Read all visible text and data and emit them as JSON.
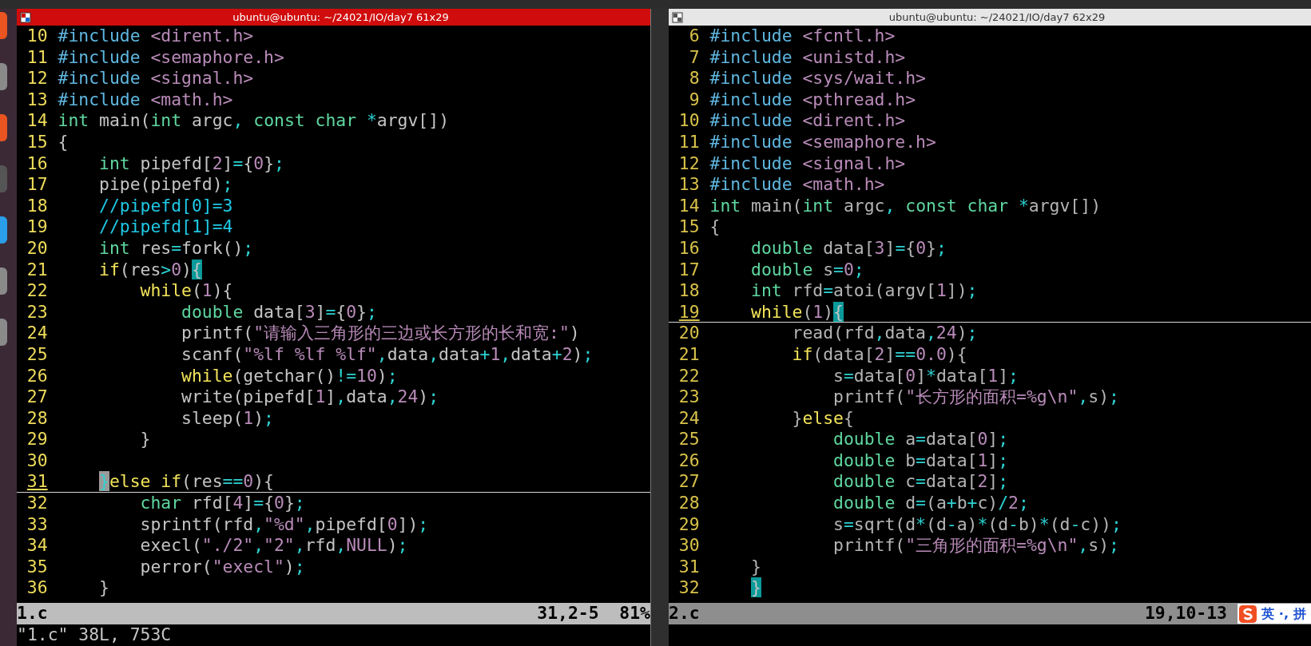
{
  "windows": [
    {
      "title": "ubuntu@ubuntu: ~/24021/IO/day7 61x29",
      "active": true,
      "lines": [
        {
          "n": "10",
          "cursorline": false,
          "tokens": [
            {
              "t": "#include",
              "kind": "pre"
            },
            {
              "t": " <dirent.h>",
              "kind": "str"
            }
          ]
        },
        {
          "n": "11",
          "cursorline": false,
          "tokens": [
            {
              "t": "#include",
              "kind": "pre"
            },
            {
              "t": " <semaphore.h>",
              "kind": "str"
            }
          ]
        },
        {
          "n": "12",
          "cursorline": false,
          "tokens": [
            {
              "t": "#include",
              "kind": "pre"
            },
            {
              "t": " <signal.h>",
              "kind": "str"
            }
          ]
        },
        {
          "n": "13",
          "cursorline": false,
          "tokens": [
            {
              "t": "#include",
              "kind": "pre"
            },
            {
              "t": " <math.h>",
              "kind": "str"
            }
          ]
        },
        {
          "n": "14",
          "cursorline": false,
          "tokens": [
            {
              "t": "int",
              "kind": "type"
            },
            {
              "t": " main(",
              "kind": "txt"
            },
            {
              "t": "int",
              "kind": "type"
            },
            {
              "t": " argc",
              "kind": "txt"
            },
            {
              "t": ",",
              "kind": "op"
            },
            {
              "t": " const",
              "kind": "type"
            },
            {
              "t": " char",
              "kind": "type"
            },
            {
              "t": " *",
              "kind": "op"
            },
            {
              "t": "argv[])",
              "kind": "txt"
            }
          ]
        },
        {
          "n": "15",
          "cursorline": false,
          "tokens": [
            {
              "t": "{",
              "kind": "txt"
            }
          ]
        },
        {
          "n": "16",
          "cursorline": false,
          "tokens": [
            {
              "t": "    int",
              "kind": "type"
            },
            {
              "t": " pipefd[",
              "kind": "txt"
            },
            {
              "t": "2",
              "kind": "num"
            },
            {
              "t": "]",
              "kind": "txt"
            },
            {
              "t": "=",
              "kind": "op"
            },
            {
              "t": "{",
              "kind": "txt"
            },
            {
              "t": "0",
              "kind": "num"
            },
            {
              "t": "}",
              "kind": "txt"
            },
            {
              "t": ";",
              "kind": "op"
            }
          ]
        },
        {
          "n": "17",
          "cursorline": false,
          "tokens": [
            {
              "t": "    pipe(pipefd)",
              "kind": "txt"
            },
            {
              "t": ";",
              "kind": "op"
            }
          ]
        },
        {
          "n": "18",
          "cursorline": false,
          "tokens": [
            {
              "t": "    //pipefd[0]=3",
              "kind": "cmt"
            }
          ]
        },
        {
          "n": "19",
          "cursorline": false,
          "tokens": [
            {
              "t": "    //pipefd[1]=4",
              "kind": "cmt"
            }
          ]
        },
        {
          "n": "20",
          "cursorline": false,
          "tokens": [
            {
              "t": "    int",
              "kind": "type"
            },
            {
              "t": " res",
              "kind": "txt"
            },
            {
              "t": "=",
              "kind": "op"
            },
            {
              "t": "fork()",
              "kind": "txt"
            },
            {
              "t": ";",
              "kind": "op"
            }
          ]
        },
        {
          "n": "21",
          "cursorline": false,
          "tokens": [
            {
              "t": "    if",
              "kind": "stmt"
            },
            {
              "t": "(res",
              "kind": "txt"
            },
            {
              "t": ">",
              "kind": "op"
            },
            {
              "t": "0",
              "kind": "num"
            },
            {
              "t": ")",
              "kind": "txt"
            },
            {
              "t": "{",
              "kind": "match"
            }
          ]
        },
        {
          "n": "22",
          "cursorline": false,
          "tokens": [
            {
              "t": "        while",
              "kind": "stmt"
            },
            {
              "t": "(",
              "kind": "txt"
            },
            {
              "t": "1",
              "kind": "num"
            },
            {
              "t": "){",
              "kind": "txt"
            }
          ]
        },
        {
          "n": "23",
          "cursorline": false,
          "tokens": [
            {
              "t": "            double",
              "kind": "type"
            },
            {
              "t": " data[",
              "kind": "txt"
            },
            {
              "t": "3",
              "kind": "num"
            },
            {
              "t": "]",
              "kind": "txt"
            },
            {
              "t": "=",
              "kind": "op"
            },
            {
              "t": "{",
              "kind": "txt"
            },
            {
              "t": "0",
              "kind": "num"
            },
            {
              "t": "}",
              "kind": "txt"
            },
            {
              "t": ";",
              "kind": "op"
            }
          ]
        },
        {
          "n": "24",
          "cursorline": false,
          "tokens": [
            {
              "t": "            printf(",
              "kind": "txt"
            },
            {
              "t": "\"请输入三角形的三边或长方形的长和宽:\"",
              "kind": "str"
            },
            {
              "t": ")",
              "kind": "txt"
            }
          ]
        },
        {
          "n": "25",
          "cursorline": false,
          "tokens": [
            {
              "t": "            scanf(",
              "kind": "txt"
            },
            {
              "t": "\"%lf %lf %lf\"",
              "kind": "str"
            },
            {
              "t": ",",
              "kind": "op"
            },
            {
              "t": "data",
              "kind": "txt"
            },
            {
              "t": ",",
              "kind": "op"
            },
            {
              "t": "data",
              "kind": "txt"
            },
            {
              "t": "+",
              "kind": "op"
            },
            {
              "t": "1",
              "kind": "num"
            },
            {
              "t": ",",
              "kind": "op"
            },
            {
              "t": "data",
              "kind": "txt"
            },
            {
              "t": "+",
              "kind": "op"
            },
            {
              "t": "2",
              "kind": "num"
            },
            {
              "t": ")",
              "kind": "txt"
            },
            {
              "t": ";",
              "kind": "op"
            }
          ]
        },
        {
          "n": "26",
          "cursorline": false,
          "tokens": [
            {
              "t": "            while",
              "kind": "stmt"
            },
            {
              "t": "(getchar()",
              "kind": "txt"
            },
            {
              "t": "!=",
              "kind": "op"
            },
            {
              "t": "10",
              "kind": "num"
            },
            {
              "t": ")",
              "kind": "txt"
            },
            {
              "t": ";",
              "kind": "op"
            }
          ]
        },
        {
          "n": "27",
          "cursorline": false,
          "tokens": [
            {
              "t": "            write(pipefd[",
              "kind": "txt"
            },
            {
              "t": "1",
              "kind": "num"
            },
            {
              "t": "]",
              "kind": "txt"
            },
            {
              "t": ",",
              "kind": "op"
            },
            {
              "t": "data",
              "kind": "txt"
            },
            {
              "t": ",",
              "kind": "op"
            },
            {
              "t": "24",
              "kind": "num"
            },
            {
              "t": ")",
              "kind": "txt"
            },
            {
              "t": ";",
              "kind": "op"
            }
          ]
        },
        {
          "n": "28",
          "cursorline": false,
          "tokens": [
            {
              "t": "            sleep(",
              "kind": "txt"
            },
            {
              "t": "1",
              "kind": "num"
            },
            {
              "t": ")",
              "kind": "txt"
            },
            {
              "t": ";",
              "kind": "op"
            }
          ]
        },
        {
          "n": "29",
          "cursorline": false,
          "tokens": [
            {
              "t": "        }",
              "kind": "txt"
            }
          ]
        },
        {
          "n": "30",
          "cursorline": false
        },
        {
          "n": "31",
          "cursorline": true,
          "tokens": [
            {
              "t": "    }",
              "kind": "cursor"
            },
            {
              "t": "else if",
              "kind": "stmt"
            },
            {
              "t": "(res",
              "kind": "txt"
            },
            {
              "t": "==",
              "kind": "op"
            },
            {
              "t": "0",
              "kind": "num"
            },
            {
              "t": "){",
              "kind": "txt"
            }
          ]
        },
        {
          "n": "32",
          "cursorline": false,
          "tokens": [
            {
              "t": "        char",
              "kind": "type"
            },
            {
              "t": " rfd[",
              "kind": "txt"
            },
            {
              "t": "4",
              "kind": "num"
            },
            {
              "t": "]",
              "kind": "txt"
            },
            {
              "t": "=",
              "kind": "op"
            },
            {
              "t": "{",
              "kind": "txt"
            },
            {
              "t": "0",
              "kind": "num"
            },
            {
              "t": "}",
              "kind": "txt"
            },
            {
              "t": ";",
              "kind": "op"
            }
          ]
        },
        {
          "n": "33",
          "cursorline": false,
          "tokens": [
            {
              "t": "        sprintf(rfd",
              "kind": "txt"
            },
            {
              "t": ",",
              "kind": "op"
            },
            {
              "t": "\"%d\"",
              "kind": "str"
            },
            {
              "t": ",",
              "kind": "op"
            },
            {
              "t": "pipefd[",
              "kind": "txt"
            },
            {
              "t": "0",
              "kind": "num"
            },
            {
              "t": "])",
              "kind": "txt"
            },
            {
              "t": ";",
              "kind": "op"
            }
          ]
        },
        {
          "n": "34",
          "cursorline": false,
          "tokens": [
            {
              "t": "        execl(",
              "kind": "txt"
            },
            {
              "t": "\"./2\"",
              "kind": "str"
            },
            {
              "t": ",",
              "kind": "op"
            },
            {
              "t": "\"2\"",
              "kind": "str"
            },
            {
              "t": ",",
              "kind": "op"
            },
            {
              "t": "rfd",
              "kind": "txt"
            },
            {
              "t": ",",
              "kind": "op"
            },
            {
              "t": "NULL",
              "kind": "num"
            },
            {
              "t": ")",
              "kind": "txt"
            },
            {
              "t": ";",
              "kind": "op"
            }
          ]
        },
        {
          "n": "35",
          "cursorline": false,
          "tokens": [
            {
              "t": "        perror(",
              "kind": "txt"
            },
            {
              "t": "\"execl\"",
              "kind": "str"
            },
            {
              "t": ")",
              "kind": "txt"
            },
            {
              "t": ";",
              "kind": "op"
            }
          ]
        },
        {
          "n": "36",
          "cursorline": false,
          "tokens": [
            {
              "t": "    }",
              "kind": "txt"
            }
          ]
        }
      ],
      "status": {
        "file": "1.c",
        "position": "31,2-5",
        "percent": "81%"
      },
      "command_line": "\"1.c\" 38L, 753C"
    },
    {
      "title": "ubuntu@ubuntu: ~/24021/IO/day7 62x29",
      "active": false,
      "lines": [
        {
          "n": "6",
          "cursorline": false,
          "tokens": [
            {
              "t": "#include",
              "kind": "pre"
            },
            {
              "t": " <fcntl.h>",
              "kind": "str"
            }
          ]
        },
        {
          "n": "7",
          "cursorline": false,
          "tokens": [
            {
              "t": "#include",
              "kind": "pre"
            },
            {
              "t": " <unistd.h>",
              "kind": "str"
            }
          ]
        },
        {
          "n": "8",
          "cursorline": false,
          "tokens": [
            {
              "t": "#include",
              "kind": "pre"
            },
            {
              "t": " <sys/wait.h>",
              "kind": "str"
            }
          ]
        },
        {
          "n": "9",
          "cursorline": false,
          "tokens": [
            {
              "t": "#include",
              "kind": "pre"
            },
            {
              "t": " <pthread.h>",
              "kind": "str"
            }
          ]
        },
        {
          "n": "10",
          "cursorline": false,
          "tokens": [
            {
              "t": "#include",
              "kind": "pre"
            },
            {
              "t": " <dirent.h>",
              "kind": "str"
            }
          ]
        },
        {
          "n": "11",
          "cursorline": false,
          "tokens": [
            {
              "t": "#include",
              "kind": "pre"
            },
            {
              "t": " <semaphore.h>",
              "kind": "str"
            }
          ]
        },
        {
          "n": "12",
          "cursorline": false,
          "tokens": [
            {
              "t": "#include",
              "kind": "pre"
            },
            {
              "t": " <signal.h>",
              "kind": "str"
            }
          ]
        },
        {
          "n": "13",
          "cursorline": false,
          "tokens": [
            {
              "t": "#include",
              "kind": "pre"
            },
            {
              "t": " <math.h>",
              "kind": "str"
            }
          ]
        },
        {
          "n": "14",
          "cursorline": false,
          "tokens": [
            {
              "t": "int",
              "kind": "type"
            },
            {
              "t": " main(",
              "kind": "txt"
            },
            {
              "t": "int",
              "kind": "type"
            },
            {
              "t": " argc",
              "kind": "txt"
            },
            {
              "t": ",",
              "kind": "op"
            },
            {
              "t": " const",
              "kind": "type"
            },
            {
              "t": " char",
              "kind": "type"
            },
            {
              "t": " *",
              "kind": "op"
            },
            {
              "t": "argv[])",
              "kind": "txt"
            }
          ]
        },
        {
          "n": "15",
          "cursorline": false,
          "tokens": [
            {
              "t": "{",
              "kind": "txt"
            }
          ]
        },
        {
          "n": "16",
          "cursorline": false,
          "tokens": [
            {
              "t": "    double",
              "kind": "type"
            },
            {
              "t": " data[",
              "kind": "txt"
            },
            {
              "t": "3",
              "kind": "num"
            },
            {
              "t": "]",
              "kind": "txt"
            },
            {
              "t": "=",
              "kind": "op"
            },
            {
              "t": "{",
              "kind": "txt"
            },
            {
              "t": "0",
              "kind": "num"
            },
            {
              "t": "}",
              "kind": "txt"
            },
            {
              "t": ";",
              "kind": "op"
            }
          ]
        },
        {
          "n": "17",
          "cursorline": false,
          "tokens": [
            {
              "t": "    double",
              "kind": "type"
            },
            {
              "t": " s",
              "kind": "txt"
            },
            {
              "t": "=",
              "kind": "op"
            },
            {
              "t": "0",
              "kind": "num"
            },
            {
              "t": ";",
              "kind": "op"
            }
          ]
        },
        {
          "n": "18",
          "cursorline": false,
          "tokens": [
            {
              "t": "    int",
              "kind": "type"
            },
            {
              "t": " rfd",
              "kind": "txt"
            },
            {
              "t": "=",
              "kind": "op"
            },
            {
              "t": "atoi(argv[",
              "kind": "txt"
            },
            {
              "t": "1",
              "kind": "num"
            },
            {
              "t": "])",
              "kind": "txt"
            },
            {
              "t": ";",
              "kind": "op"
            }
          ]
        },
        {
          "n": "19",
          "cursorline": true,
          "tokens": [
            {
              "t": "    while",
              "kind": "stmt"
            },
            {
              "t": "(",
              "kind": "txt"
            },
            {
              "t": "1",
              "kind": "num"
            },
            {
              "t": ")",
              "kind": "txt"
            },
            {
              "t": "{",
              "kind": "match"
            }
          ]
        },
        {
          "n": "20",
          "cursorline": false,
          "tokens": [
            {
              "t": "        read(rfd",
              "kind": "txt"
            },
            {
              "t": ",",
              "kind": "op"
            },
            {
              "t": "data",
              "kind": "txt"
            },
            {
              "t": ",",
              "kind": "op"
            },
            {
              "t": "24",
              "kind": "num"
            },
            {
              "t": ")",
              "kind": "txt"
            },
            {
              "t": ";",
              "kind": "op"
            }
          ]
        },
        {
          "n": "21",
          "cursorline": false,
          "tokens": [
            {
              "t": "        if",
              "kind": "stmt"
            },
            {
              "t": "(data[",
              "kind": "txt"
            },
            {
              "t": "2",
              "kind": "num"
            },
            {
              "t": "]",
              "kind": "txt"
            },
            {
              "t": "==",
              "kind": "op"
            },
            {
              "t": "0.0",
              "kind": "num"
            },
            {
              "t": "){",
              "kind": "txt"
            }
          ]
        },
        {
          "n": "22",
          "cursorline": false,
          "tokens": [
            {
              "t": "            s",
              "kind": "txt"
            },
            {
              "t": "=",
              "kind": "op"
            },
            {
              "t": "data[",
              "kind": "txt"
            },
            {
              "t": "0",
              "kind": "num"
            },
            {
              "t": "]",
              "kind": "txt"
            },
            {
              "t": "*",
              "kind": "op"
            },
            {
              "t": "data[",
              "kind": "txt"
            },
            {
              "t": "1",
              "kind": "num"
            },
            {
              "t": "]",
              "kind": "txt"
            },
            {
              "t": ";",
              "kind": "op"
            }
          ]
        },
        {
          "n": "23",
          "cursorline": false,
          "tokens": [
            {
              "t": "            printf(",
              "kind": "txt"
            },
            {
              "t": "\"长方形的面积=%g\\n\"",
              "kind": "str"
            },
            {
              "t": ",",
              "kind": "op"
            },
            {
              "t": "s)",
              "kind": "txt"
            },
            {
              "t": ";",
              "kind": "op"
            }
          ]
        },
        {
          "n": "24",
          "cursorline": false,
          "tokens": [
            {
              "t": "        }",
              "kind": "txt"
            },
            {
              "t": "else",
              "kind": "stmt"
            },
            {
              "t": "{",
              "kind": "txt"
            }
          ]
        },
        {
          "n": "25",
          "cursorline": false,
          "tokens": [
            {
              "t": "            double",
              "kind": "type"
            },
            {
              "t": " a",
              "kind": "txt"
            },
            {
              "t": "=",
              "kind": "op"
            },
            {
              "t": "data[",
              "kind": "txt"
            },
            {
              "t": "0",
              "kind": "num"
            },
            {
              "t": "]",
              "kind": "txt"
            },
            {
              "t": ";",
              "kind": "op"
            }
          ]
        },
        {
          "n": "26",
          "cursorline": false,
          "tokens": [
            {
              "t": "            double",
              "kind": "type"
            },
            {
              "t": " b",
              "kind": "txt"
            },
            {
              "t": "=",
              "kind": "op"
            },
            {
              "t": "data[",
              "kind": "txt"
            },
            {
              "t": "1",
              "kind": "num"
            },
            {
              "t": "]",
              "kind": "txt"
            },
            {
              "t": ";",
              "kind": "op"
            }
          ]
        },
        {
          "n": "27",
          "cursorline": false,
          "tokens": [
            {
              "t": "            double",
              "kind": "type"
            },
            {
              "t": " c",
              "kind": "txt"
            },
            {
              "t": "=",
              "kind": "op"
            },
            {
              "t": "data[",
              "kind": "txt"
            },
            {
              "t": "2",
              "kind": "num"
            },
            {
              "t": "]",
              "kind": "txt"
            },
            {
              "t": ";",
              "kind": "op"
            }
          ]
        },
        {
          "n": "28",
          "cursorline": false,
          "tokens": [
            {
              "t": "            double",
              "kind": "type"
            },
            {
              "t": " d",
              "kind": "txt"
            },
            {
              "t": "=",
              "kind": "op"
            },
            {
              "t": "(a",
              "kind": "txt"
            },
            {
              "t": "+",
              "kind": "op"
            },
            {
              "t": "b",
              "kind": "txt"
            },
            {
              "t": "+",
              "kind": "op"
            },
            {
              "t": "c)",
              "kind": "txt"
            },
            {
              "t": "/",
              "kind": "op"
            },
            {
              "t": "2",
              "kind": "num"
            },
            {
              "t": ";",
              "kind": "op"
            }
          ]
        },
        {
          "n": "29",
          "cursorline": false,
          "tokens": [
            {
              "t": "            s",
              "kind": "txt"
            },
            {
              "t": "=",
              "kind": "op"
            },
            {
              "t": "sqrt(d",
              "kind": "txt"
            },
            {
              "t": "*",
              "kind": "op"
            },
            {
              "t": "(d",
              "kind": "txt"
            },
            {
              "t": "-",
              "kind": "op"
            },
            {
              "t": "a)",
              "kind": "txt"
            },
            {
              "t": "*",
              "kind": "op"
            },
            {
              "t": "(d",
              "kind": "txt"
            },
            {
              "t": "-",
              "kind": "op"
            },
            {
              "t": "b)",
              "kind": "txt"
            },
            {
              "t": "*",
              "kind": "op"
            },
            {
              "t": "(d",
              "kind": "txt"
            },
            {
              "t": "-",
              "kind": "op"
            },
            {
              "t": "c))",
              "kind": "txt"
            },
            {
              "t": ";",
              "kind": "op"
            }
          ]
        },
        {
          "n": "30",
          "cursorline": false,
          "tokens": [
            {
              "t": "            printf(",
              "kind": "txt"
            },
            {
              "t": "\"三角形的面积=%g\\n\"",
              "kind": "str"
            },
            {
              "t": ",",
              "kind": "op"
            },
            {
              "t": "s)",
              "kind": "txt"
            },
            {
              "t": ";",
              "kind": "op"
            }
          ]
        },
        {
          "n": "31",
          "cursorline": false,
          "tokens": [
            {
              "t": "    }",
              "kind": "txt"
            }
          ]
        },
        {
          "n": "32",
          "cursorline": false,
          "tokens": [
            {
              "t": "    }",
              "kind": "match"
            }
          ]
        }
      ],
      "status": {
        "file": "2.c",
        "position": "19,10-13"
      },
      "ime": {
        "mode": "英",
        "punct": "·,",
        "input": "拼"
      }
    }
  ]
}
